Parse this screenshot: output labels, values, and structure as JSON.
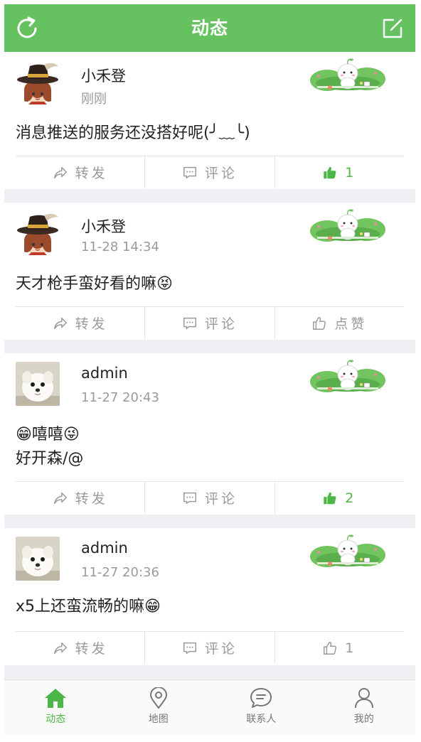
{
  "header": {
    "title": "动态"
  },
  "posts": [
    {
      "username": "小禾登",
      "time": "刚刚",
      "content": "消息推送的服务还没搭好呢(╯﹏╰)",
      "repost": "转发",
      "comment": "评论",
      "like": "1"
    },
    {
      "username": "小禾登",
      "time": "11-28 14:34",
      "content": "天才枪手蛮好看的嘛😝",
      "repost": "转发",
      "comment": "评论",
      "like": "点赞"
    },
    {
      "username": "admin",
      "time": "11-27 20:43",
      "content_line1": "😁嘻嘻😜",
      "content_line2": "好开森/@",
      "repost": "转发",
      "comment": "评论",
      "like": "2"
    },
    {
      "username": "admin",
      "time": "11-27 20:36",
      "content": "x5上还蛮流畅的嘛😁",
      "repost": "转发",
      "comment": "评论",
      "like": "1"
    }
  ],
  "tabs": [
    {
      "label": "动态"
    },
    {
      "label": "地图"
    },
    {
      "label": "联系人"
    },
    {
      "label": "我的"
    }
  ],
  "colors": {
    "accent": "#66c160",
    "liked": "#4cb748",
    "muted": "#9a9a9a"
  }
}
